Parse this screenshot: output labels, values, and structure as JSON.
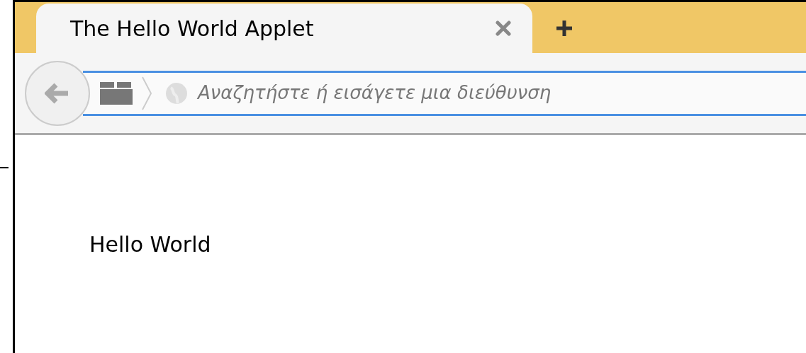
{
  "tabs": [
    {
      "title": "The Hello World Applet",
      "selected": true
    }
  ],
  "address_bar": {
    "placeholder": "Αναζητήστε ή εισάγετε μια διεύθυνση"
  },
  "page": {
    "text": "Hello World"
  }
}
